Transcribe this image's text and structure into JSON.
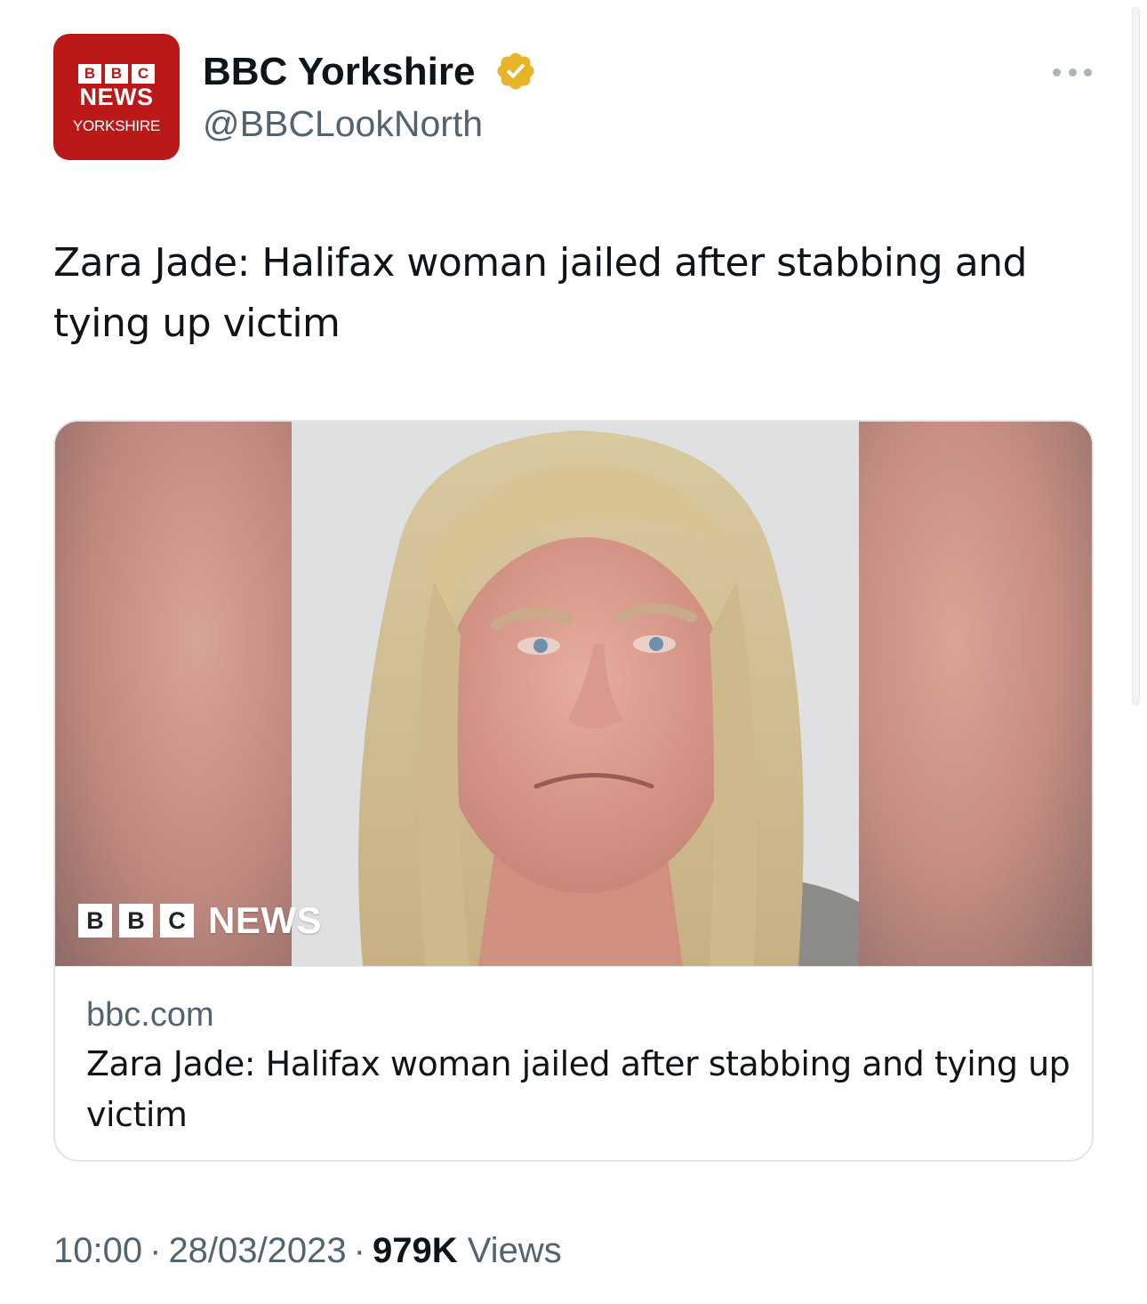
{
  "account": {
    "display_name": "BBC Yorkshire",
    "handle": "@BBCLookNorth",
    "avatar": {
      "blocks": [
        "B",
        "B",
        "C"
      ],
      "news": "NEWS",
      "region": "YORKSHIRE",
      "color": "#bb1919"
    },
    "verified_color": "#e8b42a"
  },
  "tweet": {
    "text": "Zara Jade: Halifax woman jailed after stabbing and tying up victim"
  },
  "card": {
    "image_logo_blocks": [
      "B",
      "B",
      "C"
    ],
    "image_logo_word": "NEWS",
    "domain": "bbc.com",
    "title": "Zara Jade: Halifax woman jailed after stabbing and tying up victim"
  },
  "meta": {
    "time": "10:00",
    "date": "28/03/2023",
    "views_count": "979K",
    "views_label": "Views"
  },
  "icons": [
    "verified-badge-icon",
    "more-options-icon"
  ]
}
